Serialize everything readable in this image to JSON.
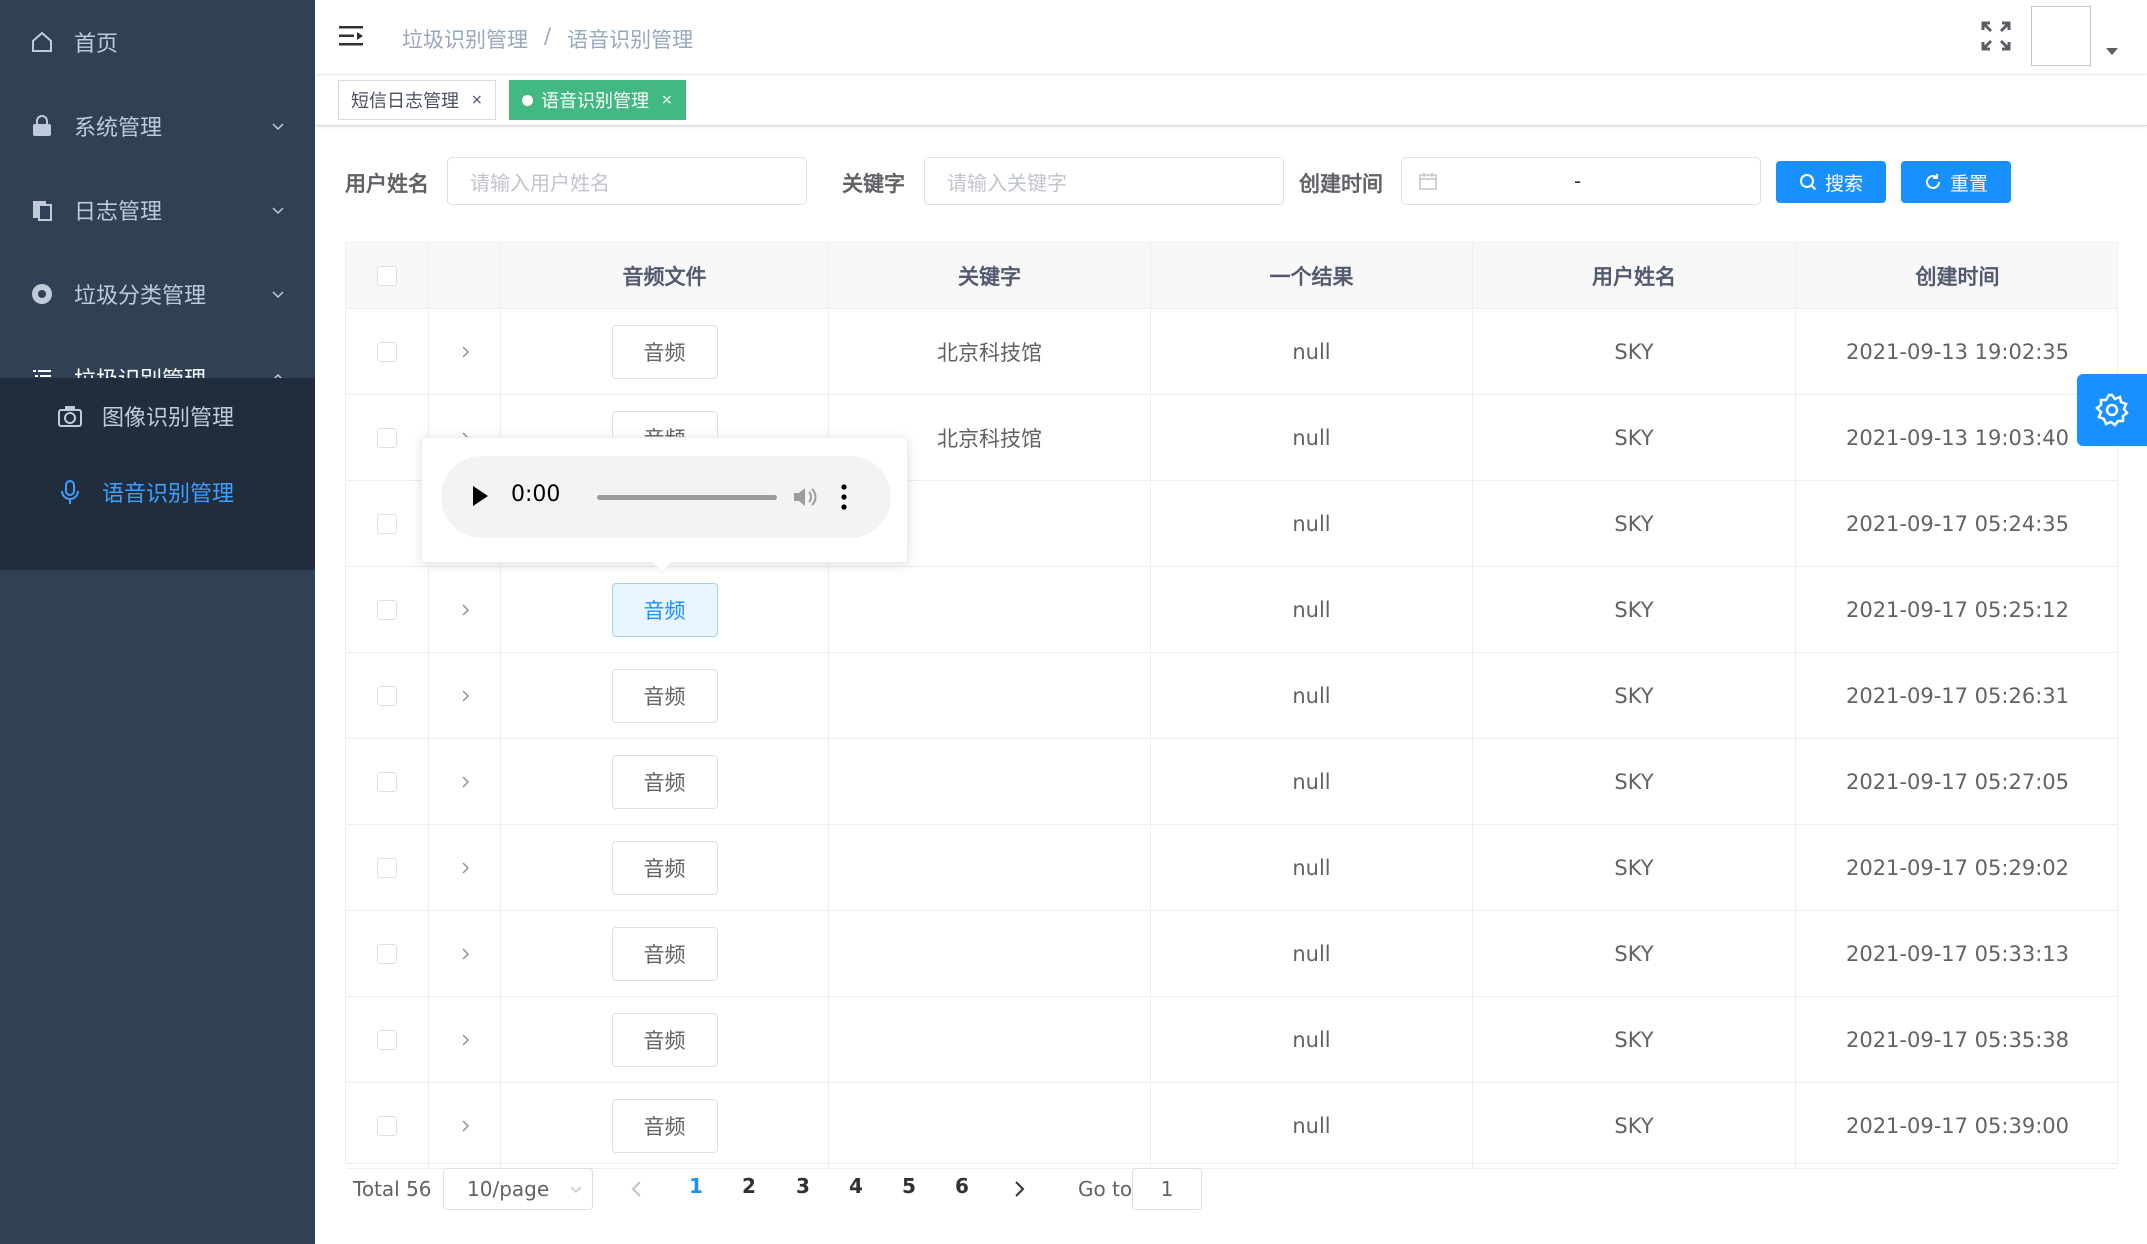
{
  "sidebar": {
    "bg_color": "#304156",
    "active_color": "#409eff",
    "items": [
      {
        "label": "首页",
        "icon": "home-icon"
      },
      {
        "label": "系统管理",
        "icon": "lock-icon"
      },
      {
        "label": "日志管理",
        "icon": "log-icon"
      },
      {
        "label": "垃圾分类管理",
        "icon": "chrome-icon"
      },
      {
        "label": "垃圾识别管理",
        "icon": "list-icon"
      }
    ],
    "sub_items": [
      {
        "label": "图像识别管理",
        "icon": "camera-icon"
      },
      {
        "label": "语音识别管理",
        "icon": "microphone-icon"
      }
    ]
  },
  "navbar": {
    "breadcrumb": [
      "垃圾识别管理",
      "语音识别管理"
    ],
    "separator": "/"
  },
  "tags": [
    {
      "label": "短信日志管理",
      "close": "×"
    },
    {
      "label": "语音识别管理",
      "close": "×",
      "active": true
    }
  ],
  "search": {
    "username_label": "用户姓名",
    "username_placeholder": "请输入用户姓名",
    "keyword_label": "关键字",
    "keyword_placeholder": "请输入关键字",
    "date_label": "创建时间",
    "date_separator": "-",
    "search_button": "搜索",
    "reset_button": "重置"
  },
  "table": {
    "headers": [
      "音频文件",
      "关键字",
      "一个结果",
      "用户姓名",
      "创建时间"
    ],
    "audio_label": "音频",
    "rows": [
      {
        "keyword": "北京科技馆",
        "result": "null",
        "user": "SKY",
        "time": "2021-09-13 19:02:35"
      },
      {
        "keyword": "北京科技馆",
        "result": "null",
        "user": "SKY",
        "time": "2021-09-13 19:03:40"
      },
      {
        "keyword": "",
        "result": "null",
        "user": "SKY",
        "time": "2021-09-17 05:24:35"
      },
      {
        "keyword": "",
        "result": "null",
        "user": "SKY",
        "time": "2021-09-17 05:25:12"
      },
      {
        "keyword": "",
        "result": "null",
        "user": "SKY",
        "time": "2021-09-17 05:26:31"
      },
      {
        "keyword": "",
        "result": "null",
        "user": "SKY",
        "time": "2021-09-17 05:27:05"
      },
      {
        "keyword": "",
        "result": "null",
        "user": "SKY",
        "time": "2021-09-17 05:29:02"
      },
      {
        "keyword": "",
        "result": "null",
        "user": "SKY",
        "time": "2021-09-17 05:33:13"
      },
      {
        "keyword": "",
        "result": "null",
        "user": "SKY",
        "time": "2021-09-17 05:35:38"
      },
      {
        "keyword": "",
        "result": "null",
        "user": "SKY",
        "time": "2021-09-17 05:39:00"
      }
    ]
  },
  "player": {
    "time": "0:00"
  },
  "pagination": {
    "total": "Total 56",
    "page_size": "10/page",
    "pages": [
      "1",
      "2",
      "3",
      "4",
      "5",
      "6"
    ],
    "current": "1",
    "goto_label": "Go to",
    "goto_value": "1"
  }
}
